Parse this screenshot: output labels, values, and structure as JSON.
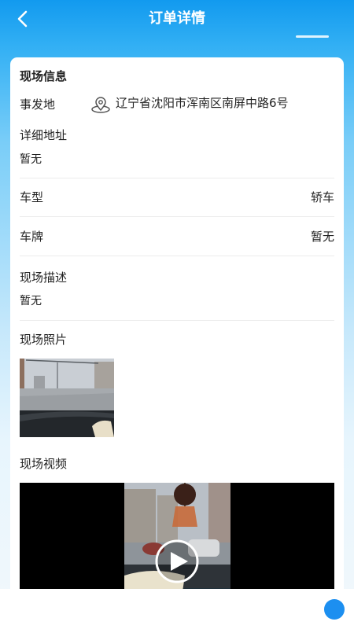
{
  "header": {
    "title": "订单详情"
  },
  "card": {
    "section_title": "现场信息",
    "location_label": "事发地",
    "location_value": "辽宁省沈阳市浑南区南屏中路6号",
    "detail_address_label": "详细地址",
    "detail_address_value": "暂无",
    "vehicle_type_label": "车型",
    "vehicle_type_value": "轿车",
    "plate_label": "车牌",
    "plate_value": "暂无",
    "description_label": "现场描述",
    "description_value": "暂无",
    "photos_label": "现场照片",
    "video_label": "现场视频"
  },
  "icons": {
    "back": "chevron-left-icon",
    "location": "map-pin-icon",
    "play": "play-icon"
  },
  "colors": {
    "header_blue": "#129aef",
    "text": "#222222",
    "divider": "#ececec"
  }
}
